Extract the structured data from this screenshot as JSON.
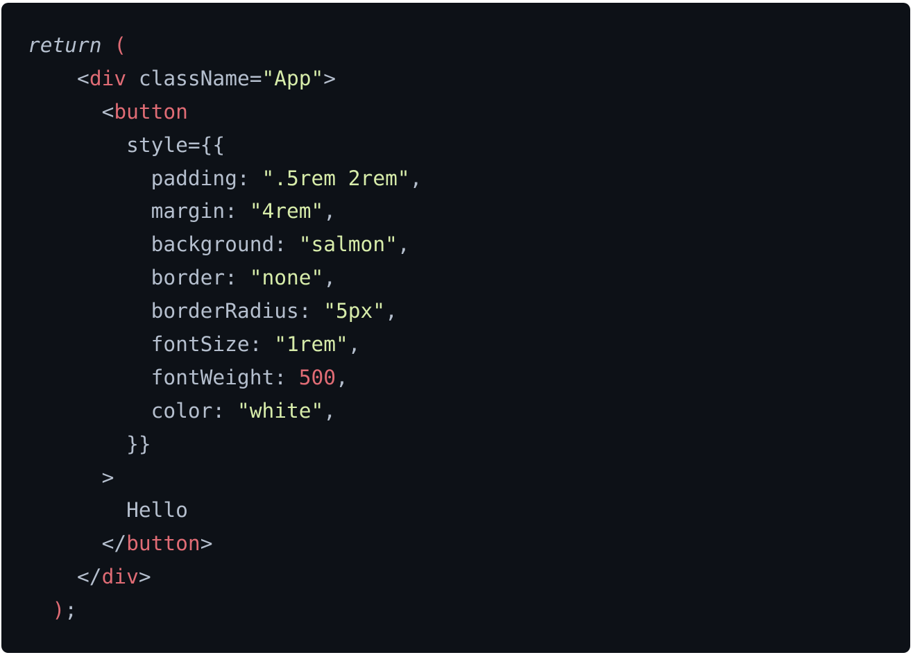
{
  "code": {
    "lines": [
      {
        "indent": 0,
        "tokens": [
          {
            "t": "kw",
            "v": "return"
          },
          {
            "t": "plain",
            "v": " "
          },
          {
            "t": "punct",
            "v": "("
          }
        ]
      },
      {
        "indent": 2,
        "tokens": [
          {
            "t": "bracket",
            "v": "<"
          },
          {
            "t": "tag",
            "v": "div"
          },
          {
            "t": "plain",
            "v": " className="
          },
          {
            "t": "str",
            "v": "\"App\""
          },
          {
            "t": "bracket",
            "v": ">"
          }
        ]
      },
      {
        "indent": 3,
        "tokens": [
          {
            "t": "bracket",
            "v": "<"
          },
          {
            "t": "tag",
            "v": "button"
          }
        ]
      },
      {
        "indent": 4,
        "tokens": [
          {
            "t": "plain",
            "v": "style={{"
          }
        ]
      },
      {
        "indent": 5,
        "tokens": [
          {
            "t": "plain",
            "v": "padding: "
          },
          {
            "t": "str",
            "v": "\".5rem 2rem\""
          },
          {
            "t": "plain",
            "v": ","
          }
        ]
      },
      {
        "indent": 5,
        "tokens": [
          {
            "t": "plain",
            "v": "margin: "
          },
          {
            "t": "str",
            "v": "\"4rem\""
          },
          {
            "t": "plain",
            "v": ","
          }
        ]
      },
      {
        "indent": 5,
        "tokens": [
          {
            "t": "plain",
            "v": "background: "
          },
          {
            "t": "str",
            "v": "\"salmon\""
          },
          {
            "t": "plain",
            "v": ","
          }
        ]
      },
      {
        "indent": 5,
        "tokens": [
          {
            "t": "plain",
            "v": "border: "
          },
          {
            "t": "str",
            "v": "\"none\""
          },
          {
            "t": "plain",
            "v": ","
          }
        ]
      },
      {
        "indent": 5,
        "tokens": [
          {
            "t": "plain",
            "v": "borderRadius: "
          },
          {
            "t": "str",
            "v": "\"5px\""
          },
          {
            "t": "plain",
            "v": ","
          }
        ]
      },
      {
        "indent": 5,
        "tokens": [
          {
            "t": "plain",
            "v": "fontSize: "
          },
          {
            "t": "str",
            "v": "\"1rem\""
          },
          {
            "t": "plain",
            "v": ","
          }
        ]
      },
      {
        "indent": 5,
        "tokens": [
          {
            "t": "plain",
            "v": "fontWeight: "
          },
          {
            "t": "num",
            "v": "500"
          },
          {
            "t": "plain",
            "v": ","
          }
        ]
      },
      {
        "indent": 5,
        "tokens": [
          {
            "t": "plain",
            "v": "color: "
          },
          {
            "t": "str",
            "v": "\"white\""
          },
          {
            "t": "plain",
            "v": ","
          }
        ]
      },
      {
        "indent": 4,
        "tokens": [
          {
            "t": "plain",
            "v": "}}"
          }
        ]
      },
      {
        "indent": 3,
        "tokens": [
          {
            "t": "bracket",
            "v": ">"
          }
        ]
      },
      {
        "indent": 4,
        "tokens": [
          {
            "t": "plain",
            "v": "Hello"
          }
        ]
      },
      {
        "indent": 3,
        "tokens": [
          {
            "t": "bracket",
            "v": "</"
          },
          {
            "t": "tag",
            "v": "button"
          },
          {
            "t": "bracket",
            "v": ">"
          }
        ]
      },
      {
        "indent": 2,
        "tokens": [
          {
            "t": "bracket",
            "v": "</"
          },
          {
            "t": "tag",
            "v": "div"
          },
          {
            "t": "bracket",
            "v": ">"
          }
        ]
      },
      {
        "indent": 1,
        "tokens": [
          {
            "t": "punct",
            "v": ")"
          },
          {
            "t": "plain",
            "v": ";"
          }
        ]
      }
    ]
  },
  "colors": {
    "background": "#0d1117",
    "text": "#b5bfce",
    "tag": "#e06c75",
    "string": "#d7ecaa",
    "number": "#e06c75"
  }
}
